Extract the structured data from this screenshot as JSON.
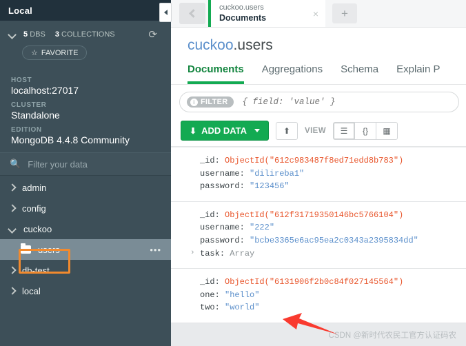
{
  "sidebar": {
    "title": "Local",
    "stats": {
      "dbs_count": "5",
      "dbs_label": "DBS",
      "collections_count": "3",
      "collections_label": "COLLECTIONS"
    },
    "refresh_icon": "refresh-icon",
    "favorite_label": "FAVORITE",
    "meta": [
      {
        "label": "HOST",
        "value": "localhost:27017"
      },
      {
        "label": "CLUSTER",
        "value": "Standalone"
      },
      {
        "label": "EDITION",
        "value": "MongoDB 4.4.8 Community"
      }
    ],
    "filter_placeholder": "Filter your data",
    "tree": [
      {
        "name": "admin",
        "type": "database",
        "expanded": false
      },
      {
        "name": "config",
        "type": "database",
        "expanded": false
      },
      {
        "name": "cuckoo",
        "type": "database",
        "expanded": true
      },
      {
        "name": "users",
        "type": "collection",
        "selected": true,
        "overflow": "•••"
      },
      {
        "name": "db-test",
        "type": "database",
        "expanded": false
      },
      {
        "name": "local",
        "type": "database",
        "expanded": false
      }
    ]
  },
  "tabbar": {
    "back_label": "back",
    "tab": {
      "namespace": "cuckoo.users",
      "name": "Documents",
      "close": "×"
    },
    "new_tab": "+"
  },
  "header": {
    "db": "cuckoo",
    "separator": ".",
    "collection": "users",
    "tabs": [
      {
        "label": "Documents",
        "active": true
      },
      {
        "label": "Aggregations",
        "active": false
      },
      {
        "label": "Schema",
        "active": false
      },
      {
        "label": "Explain P",
        "active": false
      }
    ]
  },
  "filter": {
    "badge": "FILTER",
    "info_glyph": "i",
    "placeholder": "{ field: 'value' }",
    "value": ""
  },
  "toolbar": {
    "add_data_label": "ADD DATA",
    "export_title": "export",
    "view_label": "VIEW",
    "views": [
      {
        "name": "list-view",
        "glyph": "☰",
        "active": true
      },
      {
        "name": "json-view",
        "glyph": "{}",
        "active": false
      },
      {
        "name": "table-view",
        "glyph": "▦",
        "active": false
      }
    ]
  },
  "documents": [
    {
      "fields": [
        {
          "key": "_id",
          "type": "objectid",
          "value": "ObjectId(\"612c983487f8ed71edd8b783\")"
        },
        {
          "key": "username",
          "type": "string",
          "value": "\"dilireba1\""
        },
        {
          "key": "password",
          "type": "string",
          "value": "\"123456\""
        }
      ]
    },
    {
      "fields": [
        {
          "key": "_id",
          "type": "objectid",
          "value": "ObjectId(\"612f31719350146bc5766104\")"
        },
        {
          "key": "username",
          "type": "string",
          "value": "\"222\""
        },
        {
          "key": "password",
          "type": "string",
          "value": "\"bcbe3365e6ac95ea2c0343a2395834dd\""
        },
        {
          "key": "task",
          "type": "array",
          "value": "Array",
          "expandable": true,
          "arrow": "›"
        }
      ]
    },
    {
      "fields": [
        {
          "key": "_id",
          "type": "objectid",
          "value": "ObjectId(\"6131906f2b0c84f027145564\")"
        },
        {
          "key": "one",
          "type": "string",
          "value": "\"hello\""
        },
        {
          "key": "two",
          "type": "string",
          "value": "\"world\""
        }
      ]
    }
  ],
  "annotations": {
    "highlight_box_target": "users",
    "arrow_target": "one-field",
    "arrow_color": "#F93A2F",
    "box_color": "#F28A2E"
  },
  "watermark": "CSDN @新时代农民工官方认证码农",
  "colors": {
    "sidebar_bg": "#3D4F58",
    "sidebar_header_bg": "#21313C",
    "accent_green": "#13AA52",
    "objectid_orange": "#E8552B",
    "string_blue": "#5B8FCB"
  }
}
